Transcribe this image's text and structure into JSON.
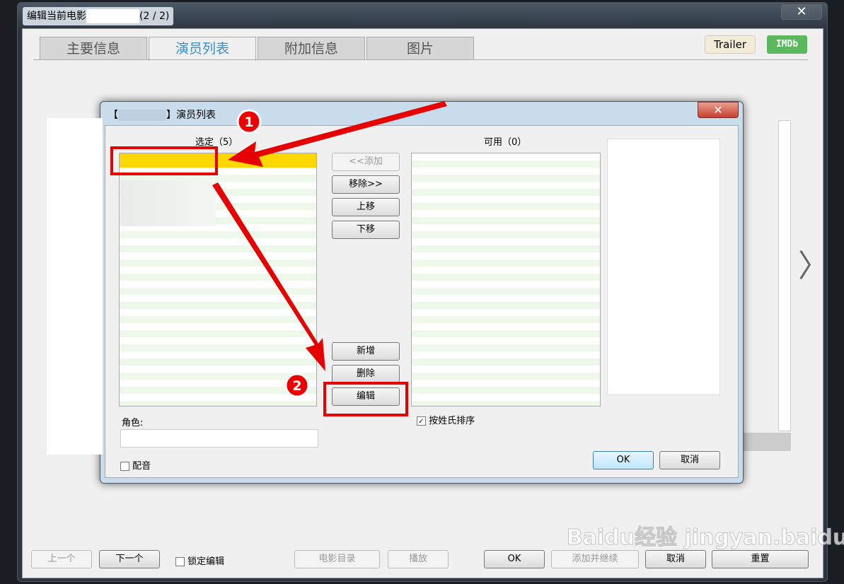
{
  "window": {
    "title": "编辑当前电影",
    "counter": "(2 / 2)",
    "close": "✕"
  },
  "tabs": [
    {
      "label": "主要信息"
    },
    {
      "label": "演员列表",
      "active": true
    },
    {
      "label": "附加信息"
    },
    {
      "label": "图片"
    }
  ],
  "header_buttons": {
    "trailer": "Trailer",
    "imdb": "IMDb"
  },
  "nav": {
    "prev": "〈",
    "next": "〉"
  },
  "dialog": {
    "title": "】演员列表",
    "title_prefix": "【",
    "close": "✕",
    "selected_label": "选定（5）",
    "available_label": "可用（0）",
    "buttons": {
      "add": "<<添加",
      "remove": "移除>>",
      "up": "上移",
      "down": "下移",
      "new": "新增",
      "delete": "删除",
      "edit": "编辑",
      "ok": "OK",
      "cancel": "取消"
    },
    "role_label": "角色:",
    "role_value": "",
    "voice_label": "配音",
    "voice_checked": false,
    "sort_label": "按姓氏排序",
    "sort_checked": true
  },
  "footer": {
    "prev": "上一个",
    "next": "下一个",
    "lock": "锁定编辑",
    "catalog": "电影目录",
    "play": "播放",
    "ok": "OK",
    "add_continue": "添加并继续",
    "cancel": "取消",
    "reset": "重置"
  },
  "annotations": {
    "step1": "1",
    "step2": "2",
    "accent": "#e60000"
  },
  "watermark": "Baidu经验 jingyan.baidu.com"
}
